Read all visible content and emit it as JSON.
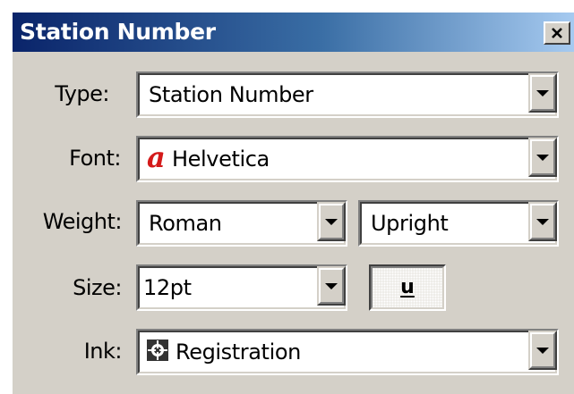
{
  "window": {
    "title": "Station Number",
    "close_glyph": "x"
  },
  "type_row": {
    "label": "Type:",
    "value": "Station Number"
  },
  "font_row": {
    "label": "Font:",
    "icon_glyph": "a",
    "value": "Helvetica"
  },
  "weight_row": {
    "label": "Weight:",
    "weight_value": "Roman",
    "style_value": "Upright"
  },
  "size_row": {
    "label": "Size:",
    "value": "12pt",
    "underline_label": "u"
  },
  "ink_row": {
    "label": "Ink:",
    "value": "Registration"
  },
  "colors": {
    "titlebar_start": "#0a246a",
    "titlebar_end": "#a6caf0",
    "dialog_bg": "#d4d0c8",
    "font_icon": "#d41a1a"
  },
  "icons": {
    "close": "close-icon",
    "dropdown": "chevron-down-icon",
    "font": "font-type-icon",
    "ink": "registration-mark-icon"
  }
}
